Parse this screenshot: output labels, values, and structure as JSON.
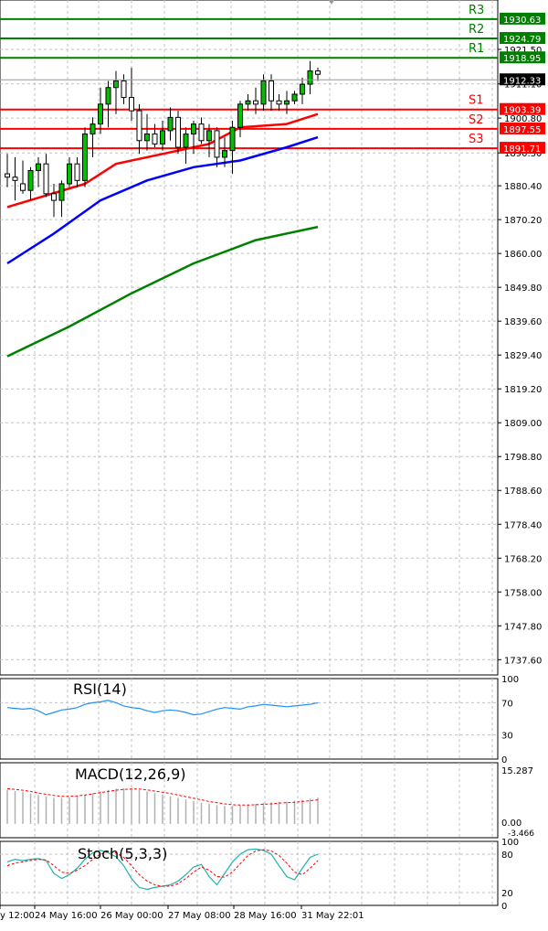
{
  "chart_data": {
    "type": "candlestick",
    "x_tick_labels": [
      "y 12:00",
      "24 May 16:00",
      "26 May 00:00",
      "27 May 08:00",
      "28 May 16:00",
      "31 May 22:01"
    ],
    "price_axis": {
      "ylim": [
        1733.0,
        1935.0
      ],
      "ticks": [
        "1921.50",
        "1911.10",
        "1900.80",
        "1890.30",
        "1880.40",
        "1870.20",
        "1860.00",
        "1849.80",
        "1839.60",
        "1829.40",
        "1819.20",
        "1809.00",
        "1798.80",
        "1788.60",
        "1778.40",
        "1768.20",
        "1758.00",
        "1747.80",
        "1737.60"
      ]
    },
    "current_price": "1912.33",
    "levels": [
      {
        "name": "R3",
        "value": "1930.63",
        "color": "#008000"
      },
      {
        "name": "R2",
        "value": "1924.79",
        "color": "#008000"
      },
      {
        "name": "R1",
        "value": "1918.95",
        "color": "#008000"
      },
      {
        "name": "S1",
        "value": "1903.39",
        "color": "#ff0000"
      },
      {
        "name": "S2",
        "value": "1897.55",
        "color": "#ff0000"
      },
      {
        "name": "S3",
        "value": "1891.71",
        "color": "#ff0000"
      }
    ],
    "candles": [
      {
        "o": 1884,
        "h": 1890,
        "l": 1880,
        "c": 1883
      },
      {
        "o": 1883,
        "h": 1889,
        "l": 1876,
        "c": 1882
      },
      {
        "o": 1881,
        "h": 1888,
        "l": 1878,
        "c": 1879
      },
      {
        "o": 1879,
        "h": 1886,
        "l": 1876,
        "c": 1885
      },
      {
        "o": 1885,
        "h": 1889,
        "l": 1880,
        "c": 1887
      },
      {
        "o": 1887,
        "h": 1890,
        "l": 1877,
        "c": 1878
      },
      {
        "o": 1878,
        "h": 1881,
        "l": 1871,
        "c": 1876
      },
      {
        "o": 1876,
        "h": 1882,
        "l": 1871,
        "c": 1881
      },
      {
        "o": 1881,
        "h": 1889,
        "l": 1880,
        "c": 1887
      },
      {
        "o": 1887,
        "h": 1889,
        "l": 1880,
        "c": 1882
      },
      {
        "o": 1882,
        "h": 1898,
        "l": 1880,
        "c": 1896
      },
      {
        "o": 1896,
        "h": 1901,
        "l": 1889,
        "c": 1899
      },
      {
        "o": 1899,
        "h": 1910,
        "l": 1896,
        "c": 1905
      },
      {
        "o": 1905,
        "h": 1912,
        "l": 1898,
        "c": 1910
      },
      {
        "o": 1910,
        "h": 1915,
        "l": 1902,
        "c": 1912
      },
      {
        "o": 1912,
        "h": 1914,
        "l": 1905,
        "c": 1907
      },
      {
        "o": 1907,
        "h": 1916,
        "l": 1900,
        "c": 1903
      },
      {
        "o": 1903,
        "h": 1905,
        "l": 1890,
        "c": 1894
      },
      {
        "o": 1894,
        "h": 1902,
        "l": 1891,
        "c": 1896
      },
      {
        "o": 1896,
        "h": 1899,
        "l": 1892,
        "c": 1893
      },
      {
        "o": 1893,
        "h": 1900,
        "l": 1891,
        "c": 1897
      },
      {
        "o": 1897,
        "h": 1904,
        "l": 1894,
        "c": 1901
      },
      {
        "o": 1901,
        "h": 1903,
        "l": 1890,
        "c": 1892
      },
      {
        "o": 1892,
        "h": 1898,
        "l": 1887,
        "c": 1896
      },
      {
        "o": 1896,
        "h": 1900,
        "l": 1890,
        "c": 1899
      },
      {
        "o": 1899,
        "h": 1901,
        "l": 1893,
        "c": 1894
      },
      {
        "o": 1894,
        "h": 1899,
        "l": 1889,
        "c": 1897
      },
      {
        "o": 1897,
        "h": 1898,
        "l": 1886,
        "c": 1889
      },
      {
        "o": 1889,
        "h": 1895,
        "l": 1886,
        "c": 1891
      },
      {
        "o": 1891,
        "h": 1900,
        "l": 1884,
        "c": 1898
      },
      {
        "o": 1898,
        "h": 1906,
        "l": 1895,
        "c": 1905
      },
      {
        "o": 1905,
        "h": 1908,
        "l": 1903,
        "c": 1906
      },
      {
        "o": 1906,
        "h": 1910,
        "l": 1902,
        "c": 1905
      },
      {
        "o": 1905,
        "h": 1914,
        "l": 1903,
        "c": 1912
      },
      {
        "o": 1912,
        "h": 1914,
        "l": 1903,
        "c": 1906
      },
      {
        "o": 1906,
        "h": 1908,
        "l": 1903,
        "c": 1905
      },
      {
        "o": 1905,
        "h": 1909,
        "l": 1902,
        "c": 1906
      },
      {
        "o": 1906,
        "h": 1909,
        "l": 1905,
        "c": 1908
      },
      {
        "o": 1908,
        "h": 1913,
        "l": 1905,
        "c": 1911
      },
      {
        "o": 1911,
        "h": 1918,
        "l": 1908,
        "c": 1915
      },
      {
        "o": 1915,
        "h": 1916,
        "l": 1912,
        "c": 1914
      }
    ],
    "moving_averages": [
      {
        "color": "#ff0000",
        "points": [
          [
            0,
            1874
          ],
          [
            10,
            1881
          ],
          [
            14,
            1887
          ],
          [
            20,
            1890
          ],
          [
            26,
            1893
          ],
          [
            30,
            1898
          ],
          [
            36,
            1899
          ],
          [
            40,
            1902
          ]
        ]
      },
      {
        "color": "#0000ff",
        "points": [
          [
            0,
            1857
          ],
          [
            6,
            1866
          ],
          [
            12,
            1876
          ],
          [
            18,
            1882
          ],
          [
            24,
            1886
          ],
          [
            30,
            1888
          ],
          [
            36,
            1892
          ],
          [
            40,
            1895
          ]
        ]
      },
      {
        "color": "#008000",
        "points": [
          [
            0,
            1829
          ],
          [
            8,
            1838
          ],
          [
            16,
            1848
          ],
          [
            24,
            1857
          ],
          [
            32,
            1864
          ],
          [
            40,
            1868
          ]
        ]
      }
    ],
    "rsi": {
      "label": "RSI(14)",
      "ticks": [
        "100",
        "70",
        "30",
        "0"
      ],
      "ylim": [
        0,
        100
      ],
      "values": [
        64,
        63,
        62,
        63,
        60,
        55,
        58,
        61,
        62,
        64,
        68,
        70,
        71,
        73,
        70,
        66,
        64,
        63,
        60,
        58,
        60,
        61,
        60,
        58,
        55,
        56,
        59,
        62,
        64,
        63,
        62,
        65,
        66,
        68,
        67,
        66,
        65,
        66,
        67,
        68,
        70
      ]
    },
    "macd": {
      "label": "MACD(12,26,9)",
      "ticks": [
        "15.287",
        "0.00",
        "-3.466"
      ],
      "ylim": [
        -3.466,
        15.287
      ],
      "histogram": [
        8.5,
        8.2,
        8.0,
        7.6,
        7.2,
        6.8,
        6.5,
        6.5,
        6.6,
        6.9,
        7.3,
        7.7,
        8.1,
        8.5,
        8.8,
        8.9,
        8.8,
        8.5,
        8.1,
        7.7,
        7.3,
        6.9,
        6.5,
        6.1,
        5.7,
        5.3,
        5.0,
        4.7,
        4.5,
        4.5,
        4.6,
        4.8,
        5.0,
        5.2,
        5.4,
        5.5,
        5.6,
        5.8,
        6.0,
        6.3,
        6.6
      ],
      "signal": [
        8.8,
        8.6,
        8.4,
        8.1,
        7.7,
        7.4,
        7.1,
        6.9,
        6.9,
        7.0,
        7.2,
        7.5,
        7.8,
        8.1,
        8.4,
        8.6,
        8.7,
        8.7,
        8.5,
        8.2,
        7.9,
        7.6,
        7.2,
        6.8,
        6.4,
        6.0,
        5.6,
        5.3,
        5.0,
        4.8,
        4.7,
        4.7,
        4.8,
        4.9,
        5.0,
        5.2,
        5.3,
        5.4,
        5.6,
        5.8,
        6.0
      ]
    },
    "stoch": {
      "label": "Stoch(5,3,3)",
      "ticks": [
        "100",
        "80",
        "20",
        "0"
      ],
      "ylim": [
        0,
        100
      ],
      "main": [
        68,
        72,
        70,
        72,
        73,
        70,
        50,
        42,
        48,
        58,
        72,
        82,
        86,
        82,
        76,
        62,
        42,
        28,
        25,
        28,
        30,
        32,
        38,
        48,
        60,
        64,
        45,
        32,
        50,
        68,
        80,
        87,
        88,
        86,
        80,
        62,
        45,
        40,
        58,
        75,
        80
      ],
      "signal": [
        62,
        66,
        68,
        70,
        72,
        71,
        62,
        52,
        50,
        55,
        62,
        72,
        80,
        84,
        82,
        75,
        62,
        48,
        38,
        32,
        30,
        30,
        34,
        42,
        52,
        60,
        55,
        45,
        44,
        52,
        65,
        78,
        85,
        87,
        85,
        78,
        66,
        52,
        48,
        58,
        70
      ]
    }
  }
}
